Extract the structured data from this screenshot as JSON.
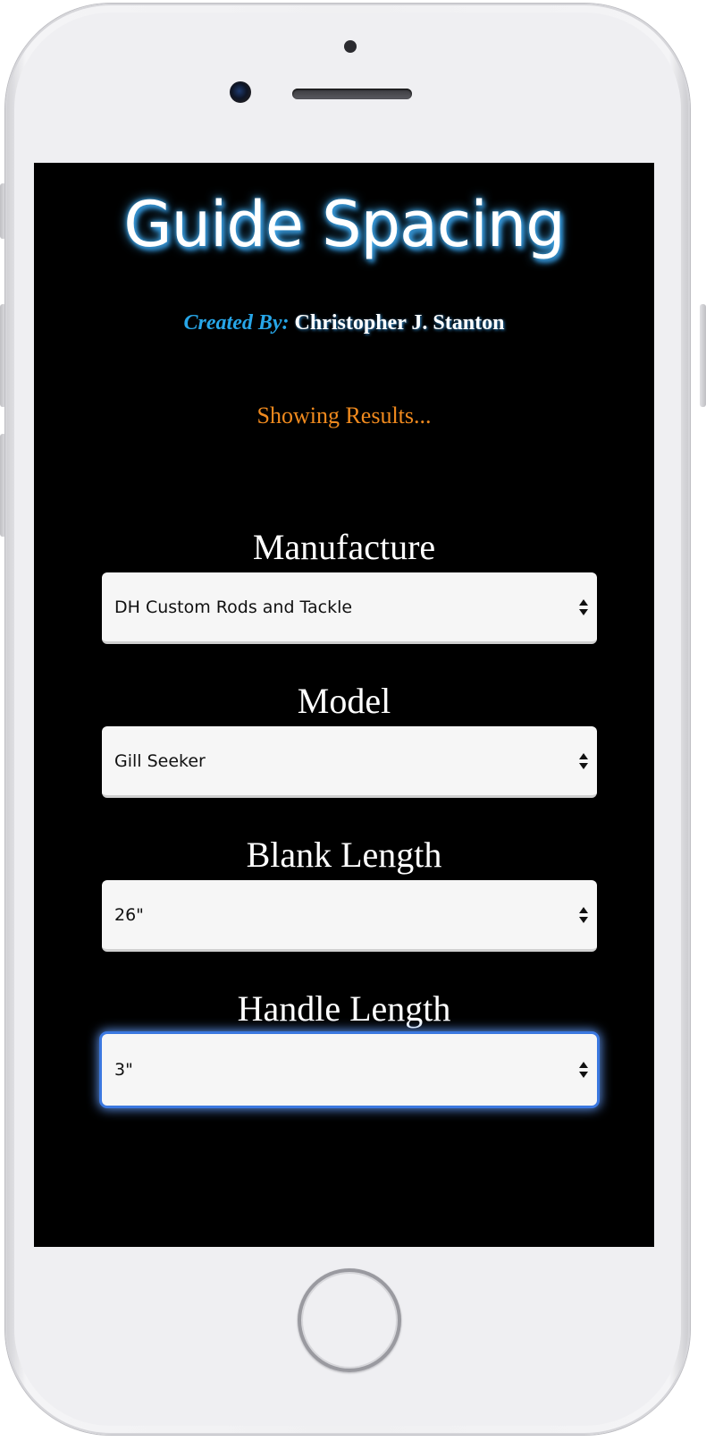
{
  "app": {
    "title": "Guide Spacing",
    "credit_prefix": "Created By:",
    "credit_name": "Christopher J. Stanton",
    "status": "Showing Results..."
  },
  "form": {
    "manufacture": {
      "label": "Manufacture",
      "selected": "DH Custom Rods and Tackle"
    },
    "model": {
      "label": "Model",
      "selected": "Gill Seeker"
    },
    "blank_length": {
      "label": "Blank Length",
      "selected": "26\""
    },
    "handle_length": {
      "label": "Handle Length",
      "selected": "3\""
    }
  },
  "colors": {
    "background": "#000000",
    "title_glow": "#3fa6e8",
    "credit_prefix": "#27a6e8",
    "status": "#f08a1e",
    "focus_ring": "#3b78e0"
  },
  "icons": {
    "select_arrows": "up-down-chevron-icon"
  }
}
